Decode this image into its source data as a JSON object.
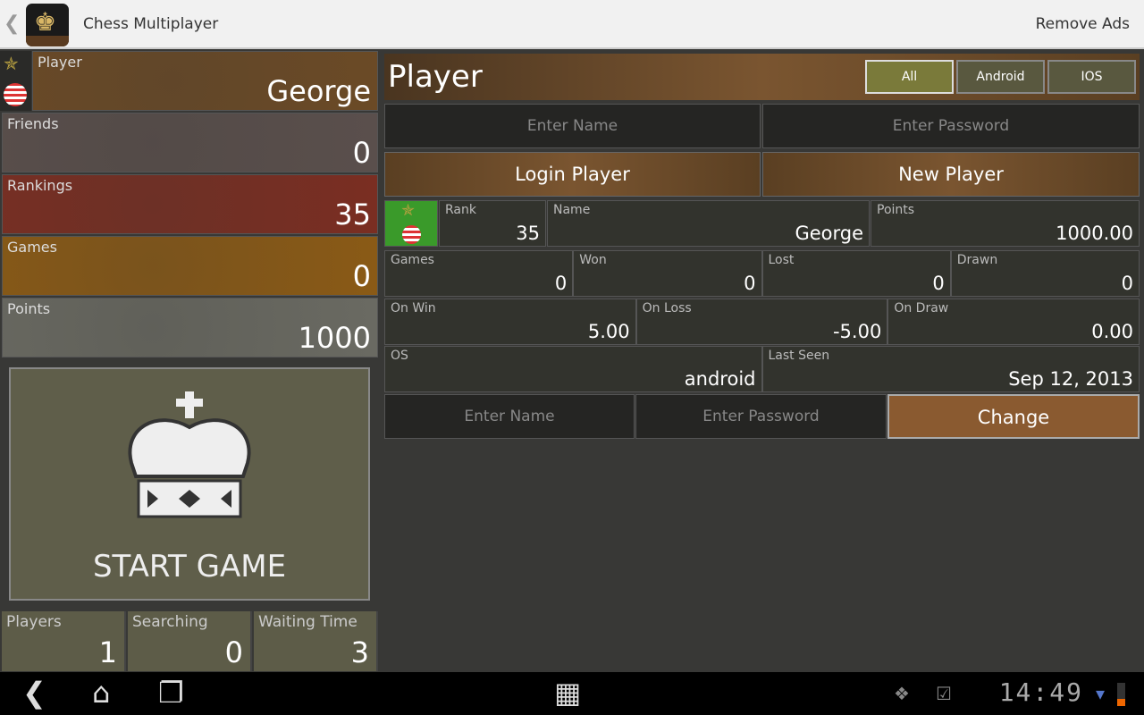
{
  "topbar": {
    "title": "Chess Multiplayer",
    "remove_ads": "Remove Ads"
  },
  "left": {
    "stats": [
      {
        "label": "Player",
        "value": "George",
        "color": "#6b4a26"
      },
      {
        "label": "Friends",
        "value": "0",
        "color": "#5a4f4c"
      },
      {
        "label": "Rankings",
        "value": "35",
        "color": "#7a2e22"
      },
      {
        "label": "Games",
        "value": "0",
        "color": "#8a5a16"
      },
      {
        "label": "Points",
        "value": "1000",
        "color": "#6a6a62"
      }
    ],
    "start_game": "START GAME",
    "bottom": [
      {
        "label": "Players",
        "value": "1"
      },
      {
        "label": "Searching",
        "value": "0"
      },
      {
        "label": "Waiting Time",
        "value": "3"
      }
    ]
  },
  "right": {
    "title": "Player",
    "filters": [
      "All",
      "Android",
      "IOS"
    ],
    "name_placeholder": "Enter Name",
    "password_placeholder": "Enter Password",
    "login": "Login Player",
    "new": "New Player",
    "rank": {
      "label": "Rank",
      "value": "35"
    },
    "name": {
      "label": "Name",
      "value": "George"
    },
    "points": {
      "label": "Points",
      "value": "1000.00"
    },
    "row2": [
      {
        "label": "Games",
        "value": "0"
      },
      {
        "label": "Won",
        "value": "0"
      },
      {
        "label": "Lost",
        "value": "0"
      },
      {
        "label": "Drawn",
        "value": "0"
      }
    ],
    "row3": [
      {
        "label": "On Win",
        "value": "5.00"
      },
      {
        "label": "On Loss",
        "value": "-5.00"
      },
      {
        "label": "On Draw",
        "value": "0.00"
      }
    ],
    "row4": [
      {
        "label": "OS",
        "value": "android"
      },
      {
        "label": "Last Seen",
        "value": "Sep 12, 2013"
      }
    ],
    "change": "Change"
  },
  "status": {
    "time": "14:49"
  }
}
